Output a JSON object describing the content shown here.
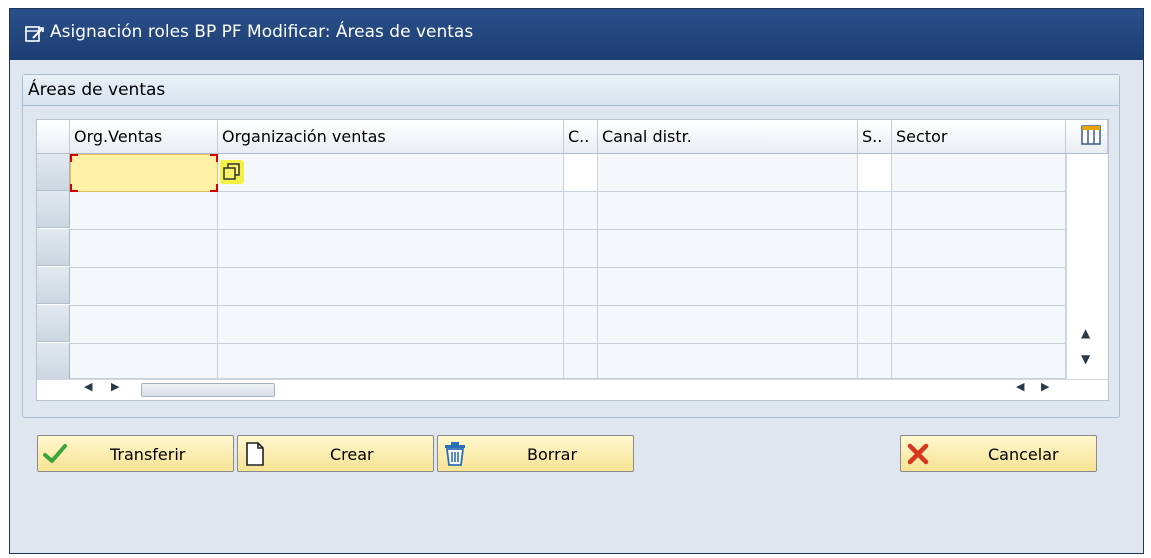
{
  "window": {
    "title": "Asignación roles BP PF Modificar: Áreas de ventas"
  },
  "group": {
    "title": "Áreas de ventas"
  },
  "table": {
    "columns": [
      "Org.Ventas",
      "Organización ventas",
      "C..",
      "Canal distr.",
      "S..",
      "Sector"
    ],
    "rows": [
      [
        "",
        "",
        "",
        "",
        "",
        ""
      ],
      [
        "",
        "",
        "",
        "",
        "",
        ""
      ],
      [
        "",
        "",
        "",
        "",
        "",
        ""
      ],
      [
        "",
        "",
        "",
        "",
        "",
        ""
      ],
      [
        "",
        "",
        "",
        "",
        "",
        ""
      ],
      [
        "",
        "",
        "",
        "",
        "",
        ""
      ]
    ]
  },
  "buttons": {
    "transfer": "Transferir",
    "create": "Crear",
    "delete": "Borrar",
    "cancel": "Cancelar"
  },
  "icons": {
    "window": "window-edit-icon",
    "column_config": "column-config-icon",
    "value_help": "value-help-icon",
    "transfer": "checkmark-icon",
    "create": "new-document-icon",
    "delete": "trash-icon",
    "cancel": "cancel-x-icon"
  },
  "colors": {
    "titlebar": "#1d3e72",
    "window_bg": "#dfe6ef",
    "input_highlight": "#fff2a6",
    "button_bg": "#f7e394",
    "check_green": "#3aa53a",
    "cancel_red": "#d9361e"
  }
}
